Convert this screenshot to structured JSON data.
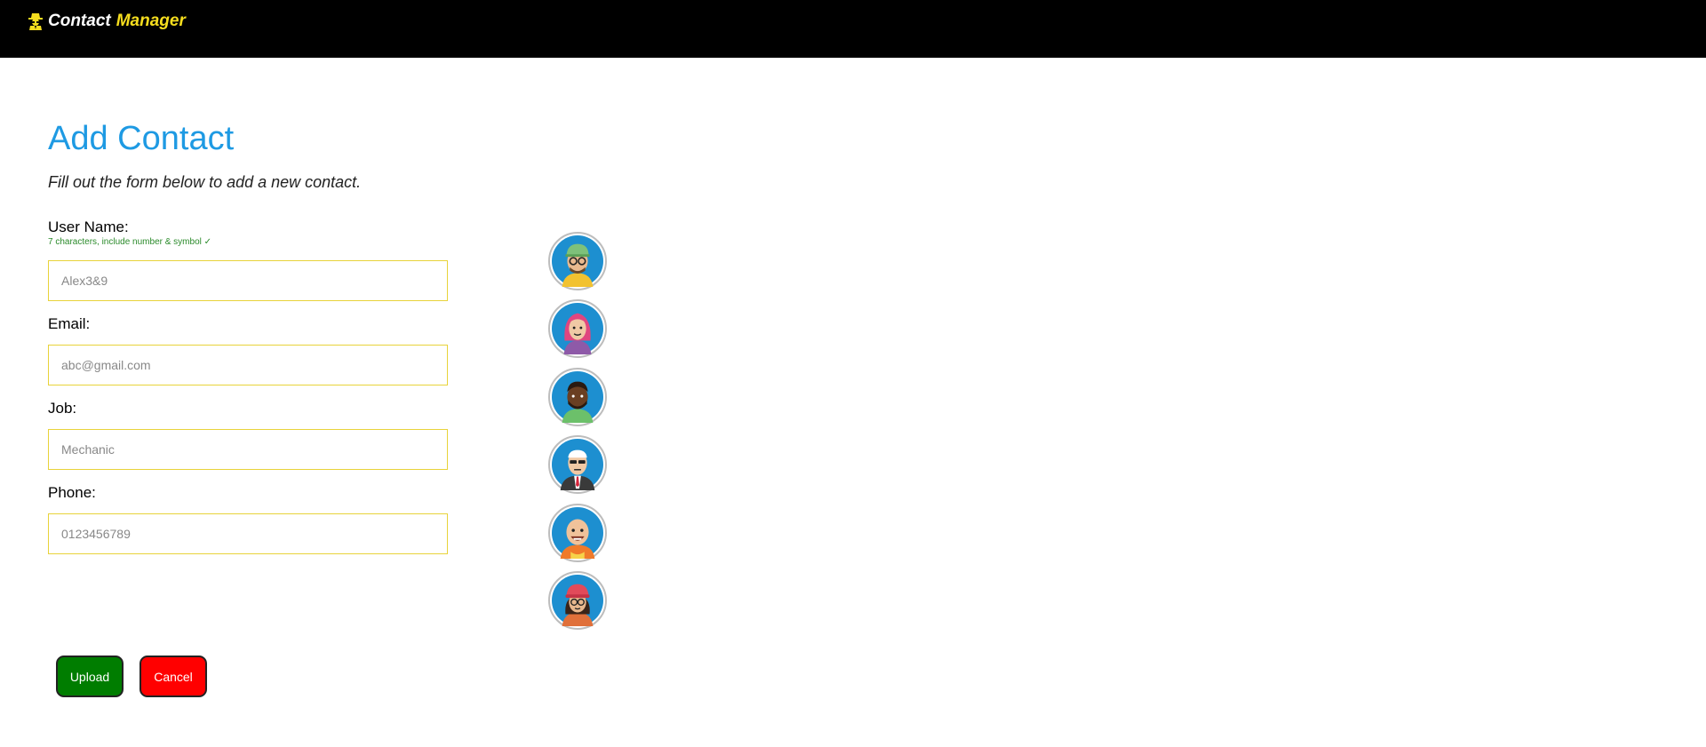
{
  "header": {
    "brand_part1": "Contact",
    "brand_part2": "Manager",
    "logo_icon": "spy-icon",
    "bar_color": "#000000",
    "accent_color": "#f5dd1e"
  },
  "form": {
    "title": "Add Contact",
    "subtitle": "Fill out the form below to add a new contact.",
    "username": {
      "label": "User Name:",
      "hint": "7 characters, include number & symbol ✓",
      "placeholder": "Alex3&9"
    },
    "email": {
      "label": "Email:",
      "placeholder": "abc@gmail.com"
    },
    "job": {
      "label": "Job:",
      "placeholder": "Mechanic"
    },
    "phone": {
      "label": "Phone:",
      "placeholder": "0123456789"
    },
    "upload_label": "Upload",
    "cancel_label": "Cancel",
    "title_color": "#1e9ae3",
    "upload_color": "#007d00",
    "cancel_color": "#ff0000"
  },
  "avatars": [
    "avatar-green-cap-glasses-icon",
    "avatar-pink-hair-icon",
    "avatar-dark-beard-icon",
    "avatar-suit-sunglasses-icon",
    "avatar-bald-smile-icon",
    "avatar-red-beanie-icon"
  ]
}
